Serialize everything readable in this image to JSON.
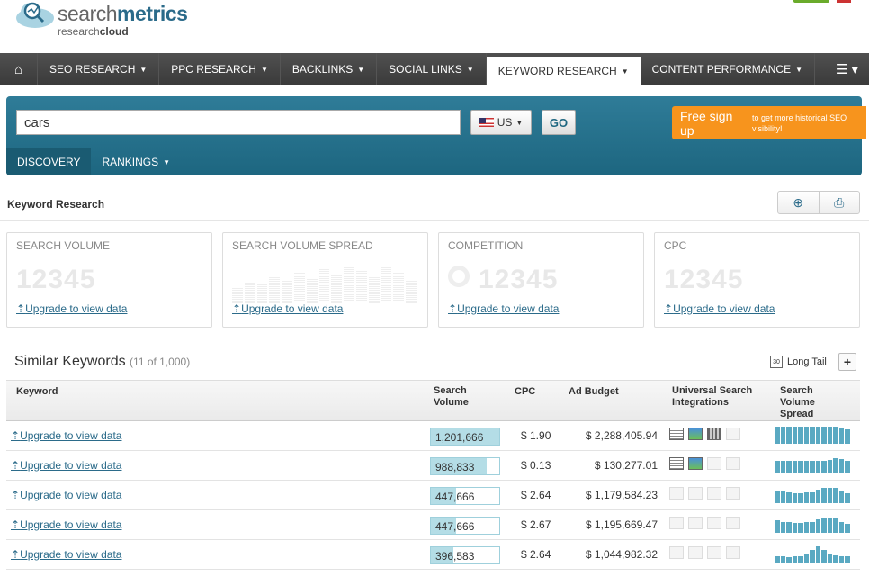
{
  "logo": {
    "main_a": "search",
    "main_b": "metrics",
    "sub_a": "research",
    "sub_b": "cloud"
  },
  "nav": {
    "items": [
      {
        "label": "SEO RESEARCH",
        "caret": "▼"
      },
      {
        "label": "PPC RESEARCH",
        "caret": "▼"
      },
      {
        "label": "BACKLINKS",
        "caret": "▼"
      },
      {
        "label": "SOCIAL LINKS",
        "caret": "▼"
      },
      {
        "label": "KEYWORD RESEARCH",
        "caret": "▼",
        "active": true
      },
      {
        "label": "CONTENT PERFORMANCE",
        "caret": "▼"
      }
    ]
  },
  "search": {
    "value": "cars",
    "country": "US",
    "go": "GO"
  },
  "signup": {
    "big": "Free sign up",
    "small": "to get more historical SEO visibility!"
  },
  "subtabs": {
    "discovery": "DISCOVERY",
    "rankings": "RANKINGS"
  },
  "page_title": "Keyword Research",
  "cards": [
    {
      "title": "SEARCH VOLUME",
      "num": "12345",
      "upgrade": "Upgrade to view data"
    },
    {
      "title": "SEARCH VOLUME SPREAD",
      "upgrade": "Upgrade to view data"
    },
    {
      "title": "COMPETITION",
      "num": "12345",
      "upgrade": "Upgrade to view data"
    },
    {
      "title": "CPC",
      "num": "12345",
      "upgrade": "Upgrade to view data"
    }
  ],
  "similar": {
    "title": "Similar Keywords",
    "count": "(11 of 1,000)",
    "longtail": "Long Tail",
    "plus": "+"
  },
  "table": {
    "headers": {
      "keyword": "Keyword",
      "volume": "Search Volume",
      "cpc": "CPC",
      "budget": "Ad Budget",
      "usi": "Universal Search Integrations",
      "spread": "Search Volume Spread"
    },
    "rows": [
      {
        "keyword": "Upgrade to view data",
        "volume": "1,201,666",
        "volume_fill": 1.0,
        "cpc": "$ 1.90",
        "budget": "$ 2,288,405.94",
        "usi": [
          1,
          1,
          1,
          0
        ],
        "spark": [
          0.95,
          0.95,
          0.95,
          0.95,
          0.95,
          0.95,
          0.95,
          0.95,
          0.95,
          0.95,
          0.95,
          0.9,
          0.8
        ]
      },
      {
        "keyword": "Upgrade to view data",
        "volume": "988,833",
        "volume_fill": 0.82,
        "cpc": "$ 0.13",
        "budget": "$ 130,277.01",
        "usi": [
          1,
          1,
          0,
          0
        ],
        "spark": [
          0.7,
          0.7,
          0.7,
          0.7,
          0.7,
          0.7,
          0.7,
          0.7,
          0.7,
          0.75,
          0.85,
          0.8,
          0.7
        ]
      },
      {
        "keyword": "Upgrade to view data",
        "volume": "447,666",
        "volume_fill": 0.37,
        "cpc": "$ 2.64",
        "budget": "$ 1,179,584.23",
        "usi": [
          0,
          0,
          0,
          0
        ],
        "spark": [
          0.7,
          0.7,
          0.6,
          0.55,
          0.55,
          0.6,
          0.6,
          0.75,
          0.85,
          0.85,
          0.85,
          0.65,
          0.55
        ]
      },
      {
        "keyword": "Upgrade to view data",
        "volume": "447,666",
        "volume_fill": 0.37,
        "cpc": "$ 2.67",
        "budget": "$ 1,195,669.47",
        "usi": [
          0,
          0,
          0,
          0
        ],
        "spark": [
          0.7,
          0.6,
          0.6,
          0.55,
          0.55,
          0.6,
          0.6,
          0.75,
          0.85,
          0.85,
          0.85,
          0.6,
          0.5
        ]
      },
      {
        "keyword": "Upgrade to view data",
        "volume": "396,583",
        "volume_fill": 0.33,
        "cpc": "$ 2.64",
        "budget": "$ 1,044,982.32",
        "usi": [
          0,
          0,
          0,
          0
        ],
        "spark": [
          0.35,
          0.35,
          0.3,
          0.35,
          0.35,
          0.5,
          0.7,
          0.9,
          0.7,
          0.5,
          0.4,
          0.35,
          0.35
        ]
      }
    ]
  },
  "colors": {
    "accent": "#2b6b8a",
    "nav": "#444444",
    "orange": "#f7941d",
    "bar": "#5aa9c2"
  }
}
